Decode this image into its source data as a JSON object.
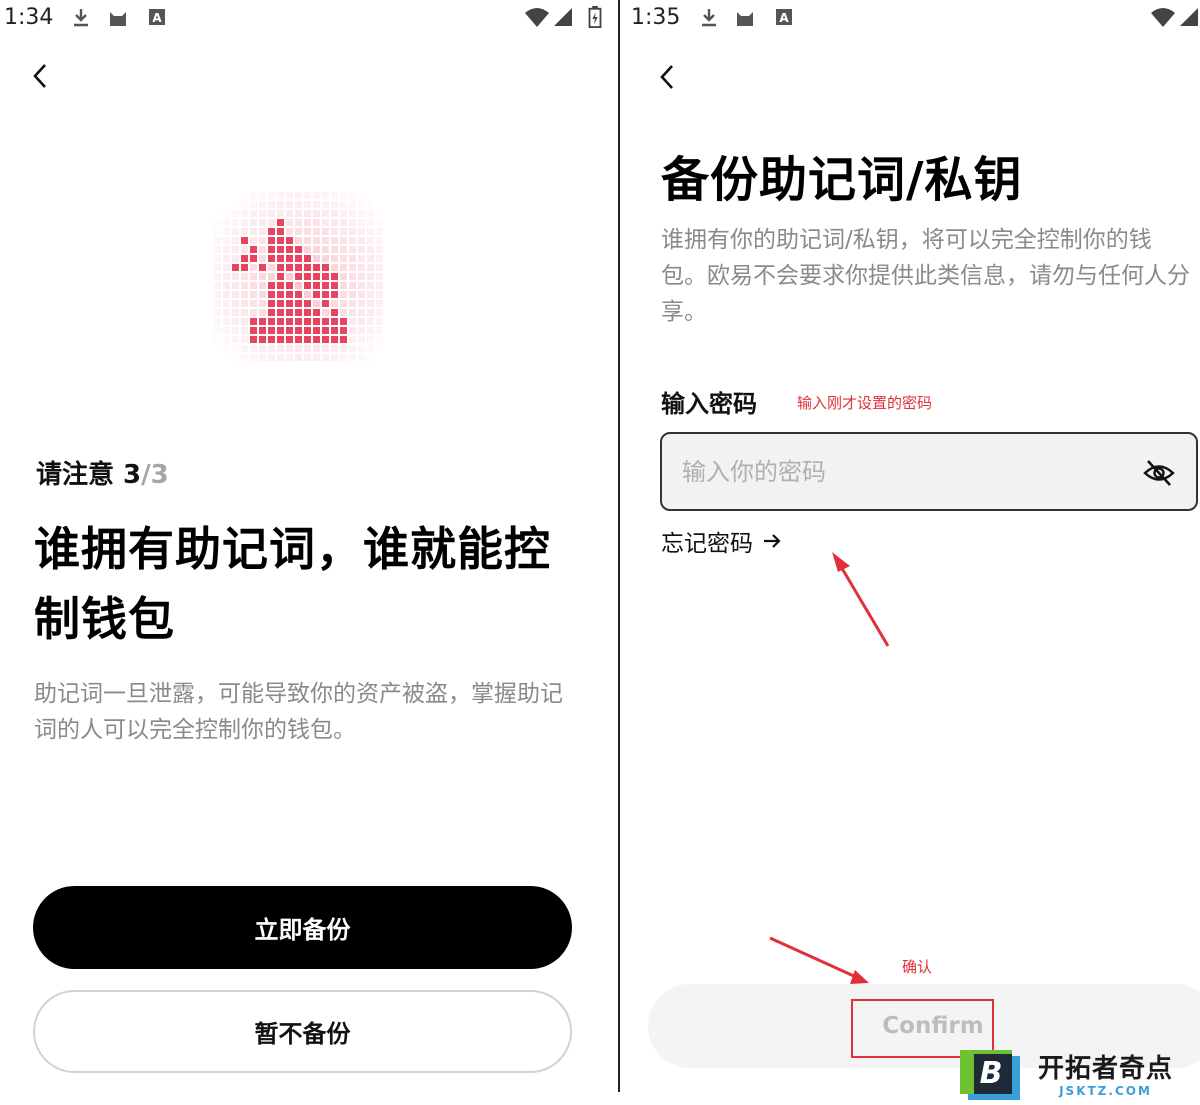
{
  "left": {
    "status": {
      "time": "1:34"
    },
    "notice": {
      "prefix": "请注意 3",
      "suffix": "/3"
    },
    "headline": "谁拥有助记词，谁就能控制钱包",
    "description": "助记词一旦泄露，可能导致你的资产被盗，掌握助记词的人可以完全控制你的钱包。",
    "primary_button": "立即备份",
    "secondary_button": "暂不备份"
  },
  "right": {
    "status": {
      "time": "1:35"
    },
    "title": "备份助记词/私钥",
    "description": "谁拥有你的助记词/私钥，将可以完全控制你的钱包。欧易不会要求你提供此类信息，请勿与任何人分享。",
    "password_label": "输入密码",
    "password_placeholder": "输入你的密码",
    "annotation_password": "输入刚才设置的密码",
    "forgot_password": "忘记密码",
    "annotation_confirm": "确认",
    "confirm_button": "Confirm"
  },
  "watermark": {
    "cn": "开拓者奇点",
    "en": "JSKTZ.COM"
  },
  "colors": {
    "accent_red": "#e0303a",
    "pixel_pink": "#e8445f"
  },
  "icons": [
    "download-icon",
    "cat-icon",
    "app-a-icon",
    "wifi-icon",
    "signal-icon",
    "battery-icon",
    "back-chevron-icon",
    "eye-off-icon",
    "arrow-right-icon"
  ]
}
